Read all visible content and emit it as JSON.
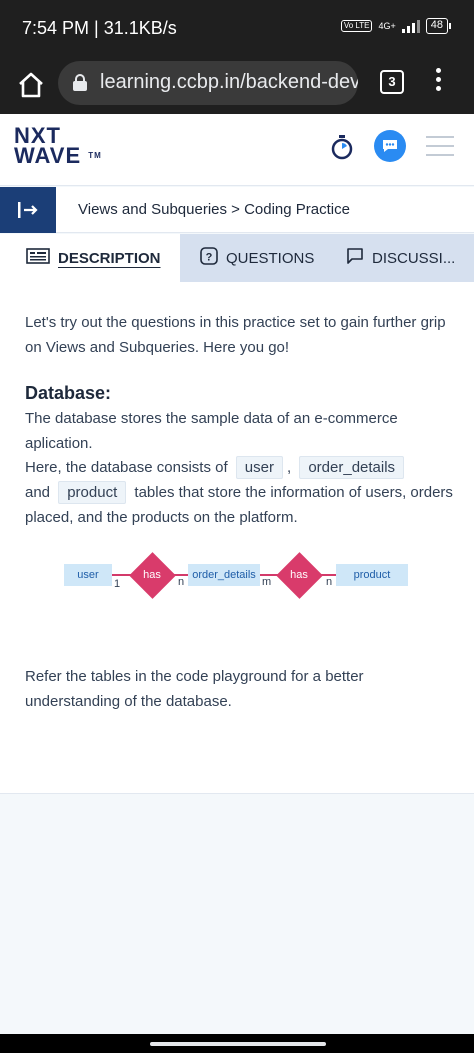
{
  "status_bar": {
    "time_speed": "7:54 PM | 31.1KB/s",
    "network": "4G+",
    "volte": "Vo LTE",
    "battery": "48"
  },
  "browser": {
    "url": "learning.ccbp.in/backend-dev",
    "tab_count": "3"
  },
  "app": {
    "logo_line1": "NXT",
    "logo_line2": "WAVE",
    "logo_tm": "TM"
  },
  "breadcrumb": "Views and Subqueries > Coding Practice",
  "tabs": [
    {
      "label": "DESCRIPTION",
      "active": true
    },
    {
      "label": "QUESTIONS",
      "active": false
    },
    {
      "label": "DISCUSSI...",
      "active": false
    }
  ],
  "content": {
    "intro": "Let's try out the questions in this practice set to gain further grip on Views and Subqueries. Here you go!",
    "db_heading": "Database:",
    "db_text1": "The database stores the sample data of an e-commerce aplication.",
    "db_text2_pre": "Here, the database consists of",
    "code_user": "user",
    "comma": ",",
    "code_order_details": "order_details",
    "and": "and",
    "code_product": "product",
    "db_text2_post": "tables that store the information of users, orders placed, and the products on the platform.",
    "footer_text": "Refer the tables in the code playground for a better understanding of the database."
  },
  "er_diagram": {
    "entity_user": "user",
    "rel_1": "has",
    "entity_order_details": "order_details",
    "rel_2": "has",
    "entity_product": "product",
    "card_1": "1",
    "card_n1": "n",
    "card_m": "m",
    "card_n2": "n"
  },
  "colors": {
    "brand_navy": "#1b2a5e",
    "accent_blue": "#2a8bf2",
    "diamond_pink": "#d93b6b",
    "entity_bg": "#cfe7f8"
  }
}
